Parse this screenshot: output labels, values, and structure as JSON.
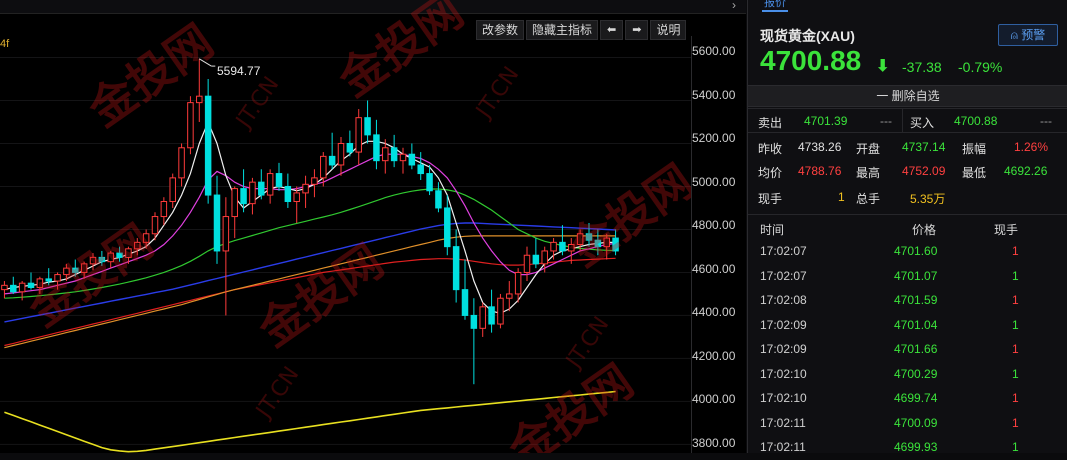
{
  "chart": {
    "buttons": [
      "改参数",
      "隐藏主指标",
      "⬅",
      "➡",
      "说明"
    ],
    "left_edge_label": "4f",
    "peak_label": "5594.77",
    "y_axis_labels": [
      "5600.00",
      "5400.00",
      "5200.00",
      "5000.00",
      "4800.00",
      "4600.00",
      "4400.00",
      "4200.00",
      "4000.00",
      "3800.00"
    ],
    "watermark": "金投网",
    "watermark_url": "JT.CN"
  },
  "chart_data": {
    "type": "candlestick",
    "ylim": [
      3760,
      5700
    ],
    "candles": [
      [
        4520,
        4560,
        4480,
        4540
      ],
      [
        4540,
        4580,
        4500,
        4510
      ],
      [
        4510,
        4560,
        4470,
        4550
      ],
      [
        4550,
        4600,
        4520,
        4530
      ],
      [
        4530,
        4580,
        4500,
        4570
      ],
      [
        4570,
        4620,
        4540,
        4560
      ],
      [
        4560,
        4600,
        4520,
        4590
      ],
      [
        4590,
        4640,
        4560,
        4620
      ],
      [
        4620,
        4660,
        4580,
        4600
      ],
      [
        4600,
        4650,
        4570,
        4640
      ],
      [
        4640,
        4690,
        4610,
        4670
      ],
      [
        4670,
        4700,
        4630,
        4650
      ],
      [
        4650,
        4700,
        4620,
        4690
      ],
      [
        4690,
        4720,
        4650,
        4670
      ],
      [
        4670,
        4720,
        4640,
        4710
      ],
      [
        4710,
        4760,
        4680,
        4740
      ],
      [
        4740,
        4800,
        4710,
        4780
      ],
      [
        4780,
        4880,
        4750,
        4860
      ],
      [
        4860,
        4950,
        4820,
        4930
      ],
      [
        4930,
        5060,
        4900,
        5040
      ],
      [
        5040,
        5200,
        5000,
        5180
      ],
      [
        5180,
        5420,
        5150,
        5390
      ],
      [
        5390,
        5594,
        5300,
        5420
      ],
      [
        5420,
        5500,
        4920,
        4960
      ],
      [
        4960,
        5050,
        4640,
        4700
      ],
      [
        4700,
        4950,
        4400,
        4860
      ],
      [
        4860,
        5000,
        4760,
        4990
      ],
      [
        4990,
        5080,
        4880,
        4920
      ],
      [
        4920,
        5040,
        4870,
        5020
      ],
      [
        5020,
        5080,
        4940,
        4960
      ],
      [
        4960,
        5080,
        4920,
        5060
      ],
      [
        5060,
        5110,
        4980,
        5000
      ],
      [
        5000,
        5060,
        4900,
        4930
      ],
      [
        4930,
        5000,
        4830,
        4970
      ],
      [
        4970,
        5050,
        4900,
        5010
      ],
      [
        5010,
        5080,
        4950,
        5040
      ],
      [
        5040,
        5160,
        5000,
        5140
      ],
      [
        5140,
        5250,
        5080,
        5100
      ],
      [
        5100,
        5230,
        5050,
        5200
      ],
      [
        5200,
        5260,
        5140,
        5160
      ],
      [
        5160,
        5360,
        5100,
        5320
      ],
      [
        5320,
        5400,
        5200,
        5240
      ],
      [
        5240,
        5310,
        5080,
        5120
      ],
      [
        5120,
        5220,
        5060,
        5180
      ],
      [
        5180,
        5240,
        5090,
        5120
      ],
      [
        5120,
        5180,
        5060,
        5150
      ],
      [
        5150,
        5200,
        5080,
        5100
      ],
      [
        5100,
        5160,
        5030,
        5060
      ],
      [
        5060,
        5100,
        4960,
        4980
      ],
      [
        4980,
        5020,
        4880,
        4900
      ],
      [
        4900,
        4960,
        4680,
        4720
      ],
      [
        4720,
        4800,
        4460,
        4520
      ],
      [
        4520,
        4660,
        4380,
        4400
      ],
      [
        4400,
        4480,
        4080,
        4340
      ],
      [
        4340,
        4460,
        4300,
        4440
      ],
      [
        4440,
        4520,
        4320,
        4360
      ],
      [
        4360,
        4500,
        4340,
        4480
      ],
      [
        4480,
        4560,
        4420,
        4500
      ],
      [
        4500,
        4620,
        4460,
        4600
      ],
      [
        4600,
        4720,
        4560,
        4680
      ],
      [
        4680,
        4760,
        4620,
        4640
      ],
      [
        4640,
        4720,
        4600,
        4700
      ],
      [
        4700,
        4760,
        4660,
        4740
      ],
      [
        4740,
        4820,
        4680,
        4700
      ],
      [
        4700,
        4760,
        4640,
        4730
      ],
      [
        4730,
        4800,
        4700,
        4780
      ],
      [
        4780,
        4830,
        4720,
        4750
      ],
      [
        4750,
        4800,
        4680,
        4720
      ],
      [
        4720,
        4780,
        4660,
        4760
      ],
      [
        4760,
        4800,
        4680,
        4700
      ]
    ],
    "ma5": [
      4520,
      4530,
      4535,
      4540,
      4545,
      4555,
      4560,
      4570,
      4590,
      4610,
      4630,
      4650,
      4660,
      4670,
      4685,
      4700,
      4720,
      4760,
      4820,
      4880,
      4960,
      5060,
      5200,
      5300,
      5200,
      5050,
      4950,
      4900,
      4930,
      4960,
      4990,
      5000,
      4990,
      4980,
      4990,
      5010,
      5040,
      5080,
      5120,
      5150,
      5190,
      5210,
      5210,
      5200,
      5180,
      5150,
      5130,
      5110,
      5090,
      5040,
      4960,
      4830,
      4700,
      4560,
      4460,
      4420,
      4410,
      4430,
      4470,
      4530,
      4590,
      4640,
      4680,
      4700,
      4710,
      4720,
      4730,
      4735,
      4740,
      4740
    ],
    "ma10": [
      4500,
      4505,
      4510,
      4515,
      4520,
      4530,
      4540,
      4550,
      4560,
      4575,
      4590,
      4605,
      4620,
      4635,
      4650,
      4665,
      4680,
      4700,
      4730,
      4770,
      4820,
      4880,
      4950,
      5030,
      5070,
      5050,
      5020,
      5000,
      4990,
      4990,
      4990,
      4985,
      4985,
      4990,
      5000,
      5010,
      5020,
      5040,
      5060,
      5080,
      5100,
      5120,
      5140,
      5150,
      5150,
      5150,
      5140,
      5130,
      5110,
      5080,
      5040,
      4980,
      4910,
      4830,
      4760,
      4700,
      4650,
      4610,
      4590,
      4590,
      4600,
      4620,
      4640,
      4660,
      4680,
      4700,
      4710,
      4720,
      4730,
      4735
    ],
    "ma20": [
      4480,
      4482,
      4485,
      4488,
      4492,
      4496,
      4500,
      4505,
      4510,
      4516,
      4523,
      4530,
      4538,
      4546,
      4555,
      4565,
      4575,
      4587,
      4600,
      4615,
      4632,
      4652,
      4675,
      4700,
      4720,
      4735,
      4748,
      4760,
      4772,
      4784,
      4796,
      4808,
      4818,
      4828,
      4838,
      4848,
      4858,
      4868,
      4880,
      4893,
      4906,
      4920,
      4934,
      4948,
      4960,
      4970,
      4978,
      4984,
      4988,
      4988,
      4984,
      4976,
      4960,
      4940,
      4915,
      4890,
      4860,
      4830,
      4800,
      4780,
      4760,
      4745,
      4735,
      4725,
      4718,
      4712,
      4708,
      4705,
      4703,
      4702
    ],
    "ma60": [
      4370,
      4378,
      4386,
      4394,
      4402,
      4410,
      4418,
      4426,
      4434,
      4442,
      4450,
      4458,
      4466,
      4474,
      4482,
      4490,
      4498,
      4506,
      4514,
      4522,
      4532,
      4542,
      4552,
      4562,
      4572,
      4582,
      4592,
      4602,
      4612,
      4622,
      4632,
      4642,
      4652,
      4662,
      4672,
      4682,
      4692,
      4702,
      4712,
      4722,
      4732,
      4742,
      4752,
      4762,
      4772,
      4782,
      4792,
      4802,
      4810,
      4818,
      4824,
      4828,
      4830,
      4830,
      4828,
      4826,
      4824,
      4822,
      4820,
      4818,
      4816,
      4814,
      4812,
      4810,
      4808,
      4806,
      4804,
      4802,
      4800,
      4798
    ],
    "ma120": [
      4250,
      4260,
      4270,
      4280,
      4290,
      4300,
      4310,
      4320,
      4330,
      4340,
      4350,
      4360,
      4370,
      4380,
      4390,
      4400,
      4410,
      4420,
      4430,
      4440,
      4450,
      4462,
      4474,
      4486,
      4498,
      4510,
      4520,
      4530,
      4540,
      4550,
      4560,
      4570,
      4580,
      4590,
      4600,
      4610,
      4620,
      4630,
      4640,
      4650,
      4660,
      4670,
      4680,
      4690,
      4700,
      4710,
      4720,
      4730,
      4740,
      4750,
      4758,
      4764,
      4768,
      4770,
      4770,
      4770,
      4770,
      4770,
      4770,
      4770,
      4770,
      4770,
      4770,
      4770,
      4770,
      4770,
      4770,
      4770,
      4770,
      4770
    ],
    "ma_red": [
      4260,
      4270,
      4280,
      4290,
      4300,
      4310,
      4320,
      4330,
      4340,
      4350,
      4360,
      4370,
      4380,
      4390,
      4400,
      4410,
      4420,
      4430,
      4440,
      4450,
      4460,
      4470,
      4480,
      4490,
      4500,
      4510,
      4520,
      4528,
      4536,
      4544,
      4552,
      4560,
      4568,
      4576,
      4584,
      4592,
      4600,
      4606,
      4612,
      4618,
      4624,
      4630,
      4636,
      4642,
      4648,
      4652,
      4656,
      4660,
      4662,
      4664,
      4664,
      4662,
      4658,
      4652,
      4646,
      4640,
      4636,
      4634,
      4634,
      4636,
      4640,
      4644,
      4648,
      4652,
      4656,
      4658,
      4660,
      4662,
      4664,
      4666
    ],
    "ma_yellow": [
      3950,
      3935,
      3920,
      3905,
      3890,
      3875,
      3860,
      3845,
      3830,
      3815,
      3800,
      3785,
      3775,
      3770,
      3766,
      3768,
      3772,
      3778,
      3784,
      3790,
      3796,
      3802,
      3808,
      3814,
      3820,
      3826,
      3832,
      3838,
      3844,
      3850,
      3856,
      3862,
      3868,
      3874,
      3880,
      3886,
      3892,
      3898,
      3904,
      3910,
      3916,
      3922,
      3928,
      3934,
      3940,
      3946,
      3952,
      3958,
      3962,
      3966,
      3970,
      3974,
      3978,
      3982,
      3986,
      3990,
      3994,
      3998,
      4002,
      4006,
      4010,
      4014,
      4018,
      4022,
      4026,
      4030,
      4034,
      4038,
      4042,
      4046
    ]
  },
  "panel": {
    "tab": "报价",
    "symbol": "现货黄金(XAU)",
    "alert_btn": "预警",
    "price": "4700.88",
    "change": "-37.38",
    "change_pct": "-0.79%",
    "remove_watchlist": "一 删除自选",
    "sell_label": "卖出",
    "sell_price": "4701.39",
    "sell_vol": "---",
    "buy_label": "买入",
    "buy_price": "4700.88",
    "buy_vol": "---",
    "prev_close_label": "昨收",
    "prev_close": "4738.26",
    "open_label": "开盘",
    "open": "4737.14",
    "amp_label": "振幅",
    "amp": "1.26%",
    "avg_label": "均价",
    "avg": "4788.76",
    "high_label": "最高",
    "high": "4752.09",
    "low_label": "最低",
    "low": "4692.26",
    "cur_vol_label": "现手",
    "cur_vol": "1",
    "total_vol_label": "总手",
    "total_vol": "5.35万",
    "col_time": "时间",
    "col_price": "价格",
    "col_vol": "现手",
    "ticks": [
      {
        "time": "17:02:07",
        "price": "4701.60",
        "vol": "1",
        "color": "red"
      },
      {
        "time": "17:02:07",
        "price": "4701.07",
        "vol": "1",
        "color": "green"
      },
      {
        "time": "17:02:08",
        "price": "4701.59",
        "vol": "1",
        "color": "red"
      },
      {
        "time": "17:02:09",
        "price": "4701.04",
        "vol": "1",
        "color": "green"
      },
      {
        "time": "17:02:09",
        "price": "4701.66",
        "vol": "1",
        "color": "red"
      },
      {
        "time": "17:02:10",
        "price": "4700.29",
        "vol": "1",
        "color": "green"
      },
      {
        "time": "17:02:10",
        "price": "4699.74",
        "vol": "1",
        "color": "red"
      },
      {
        "time": "17:02:11",
        "price": "4700.09",
        "vol": "1",
        "color": "red"
      },
      {
        "time": "17:02:11",
        "price": "4699.93",
        "vol": "1",
        "color": "green"
      }
    ]
  },
  "colors": {
    "up": "#ff3b3b",
    "down": "#00e0e0",
    "green": "#3be33b",
    "red": "#ff4040",
    "accent": "#4a8fe8"
  }
}
